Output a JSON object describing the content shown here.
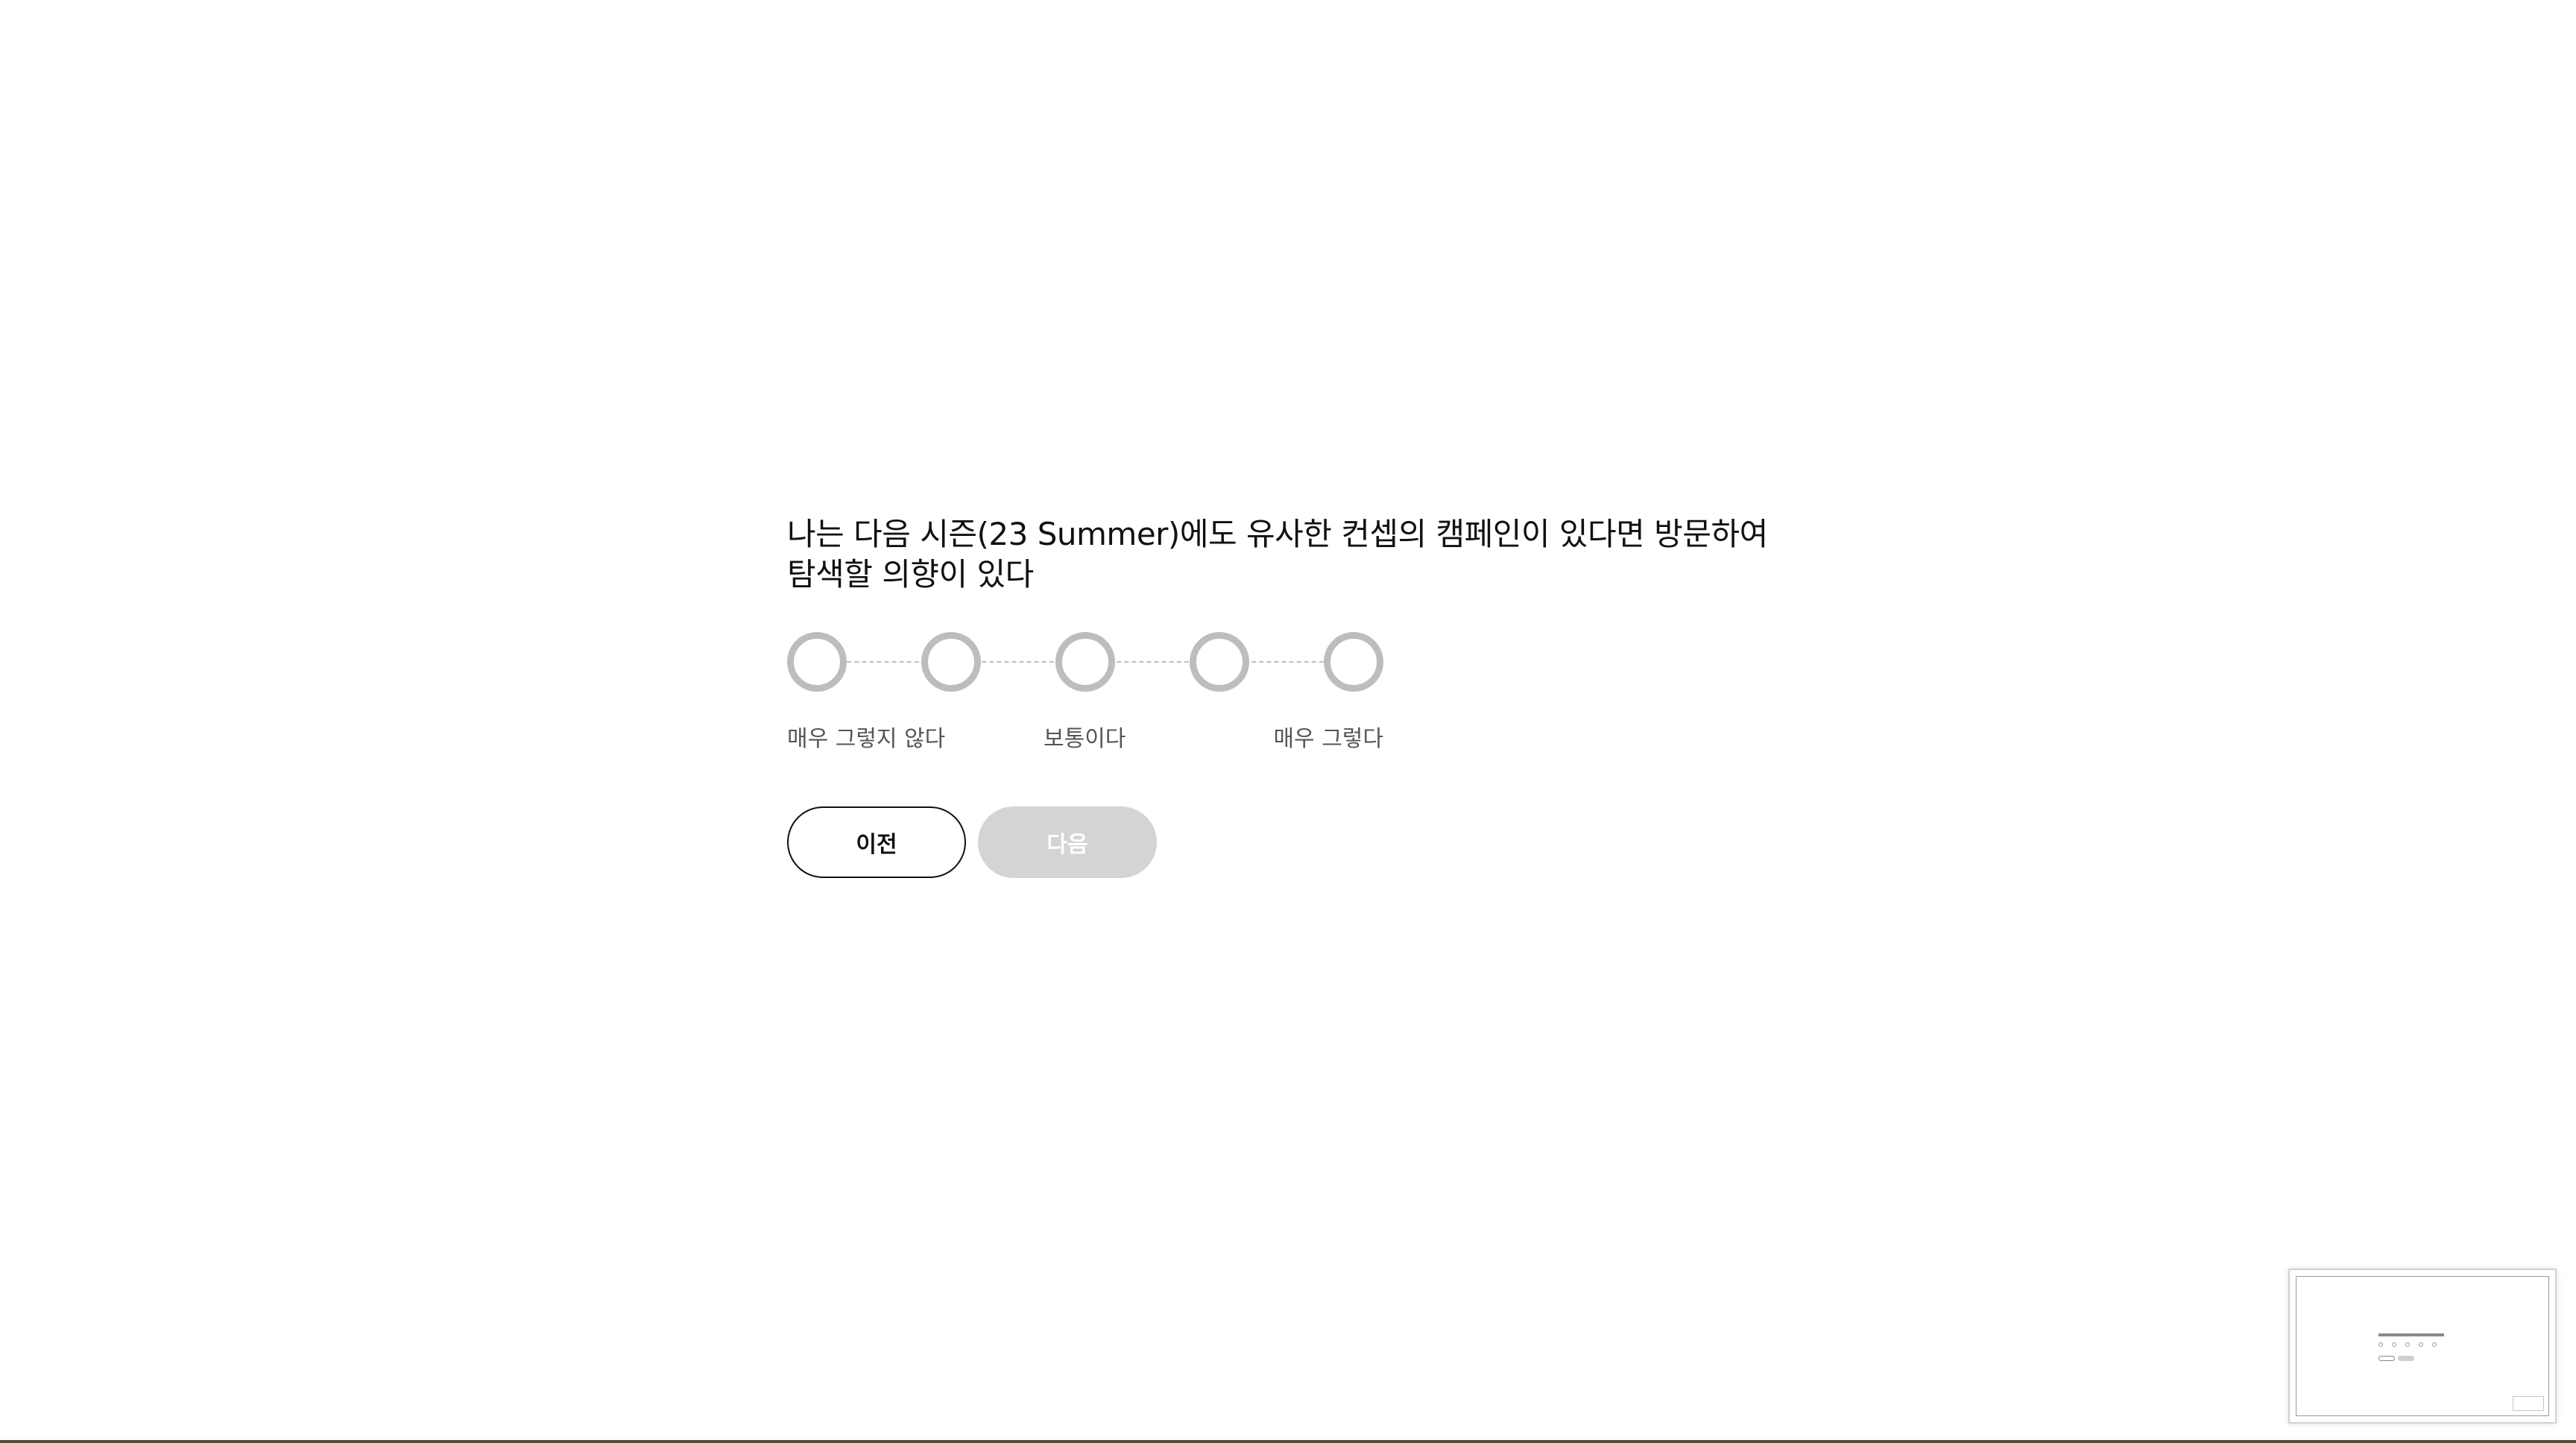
{
  "question": {
    "text": "나는 다음 시즌(23 Summer)에도 유사한 컨셉의 캠페인이 있다면 방문하여 탐색할 의향이 있다"
  },
  "scale": {
    "options": [
      "1",
      "2",
      "3",
      "4",
      "5"
    ],
    "selected": null,
    "labels": {
      "low": "매우 그렇지 않다",
      "mid": "보통이다",
      "high": "매우 그렇다"
    }
  },
  "navigation": {
    "prev_label": "이전",
    "next_label": "다음",
    "next_enabled": false
  },
  "colors": {
    "option_border": "#bdbdbd",
    "next_disabled_bg": "#d4d4d4",
    "text": "#111111"
  }
}
